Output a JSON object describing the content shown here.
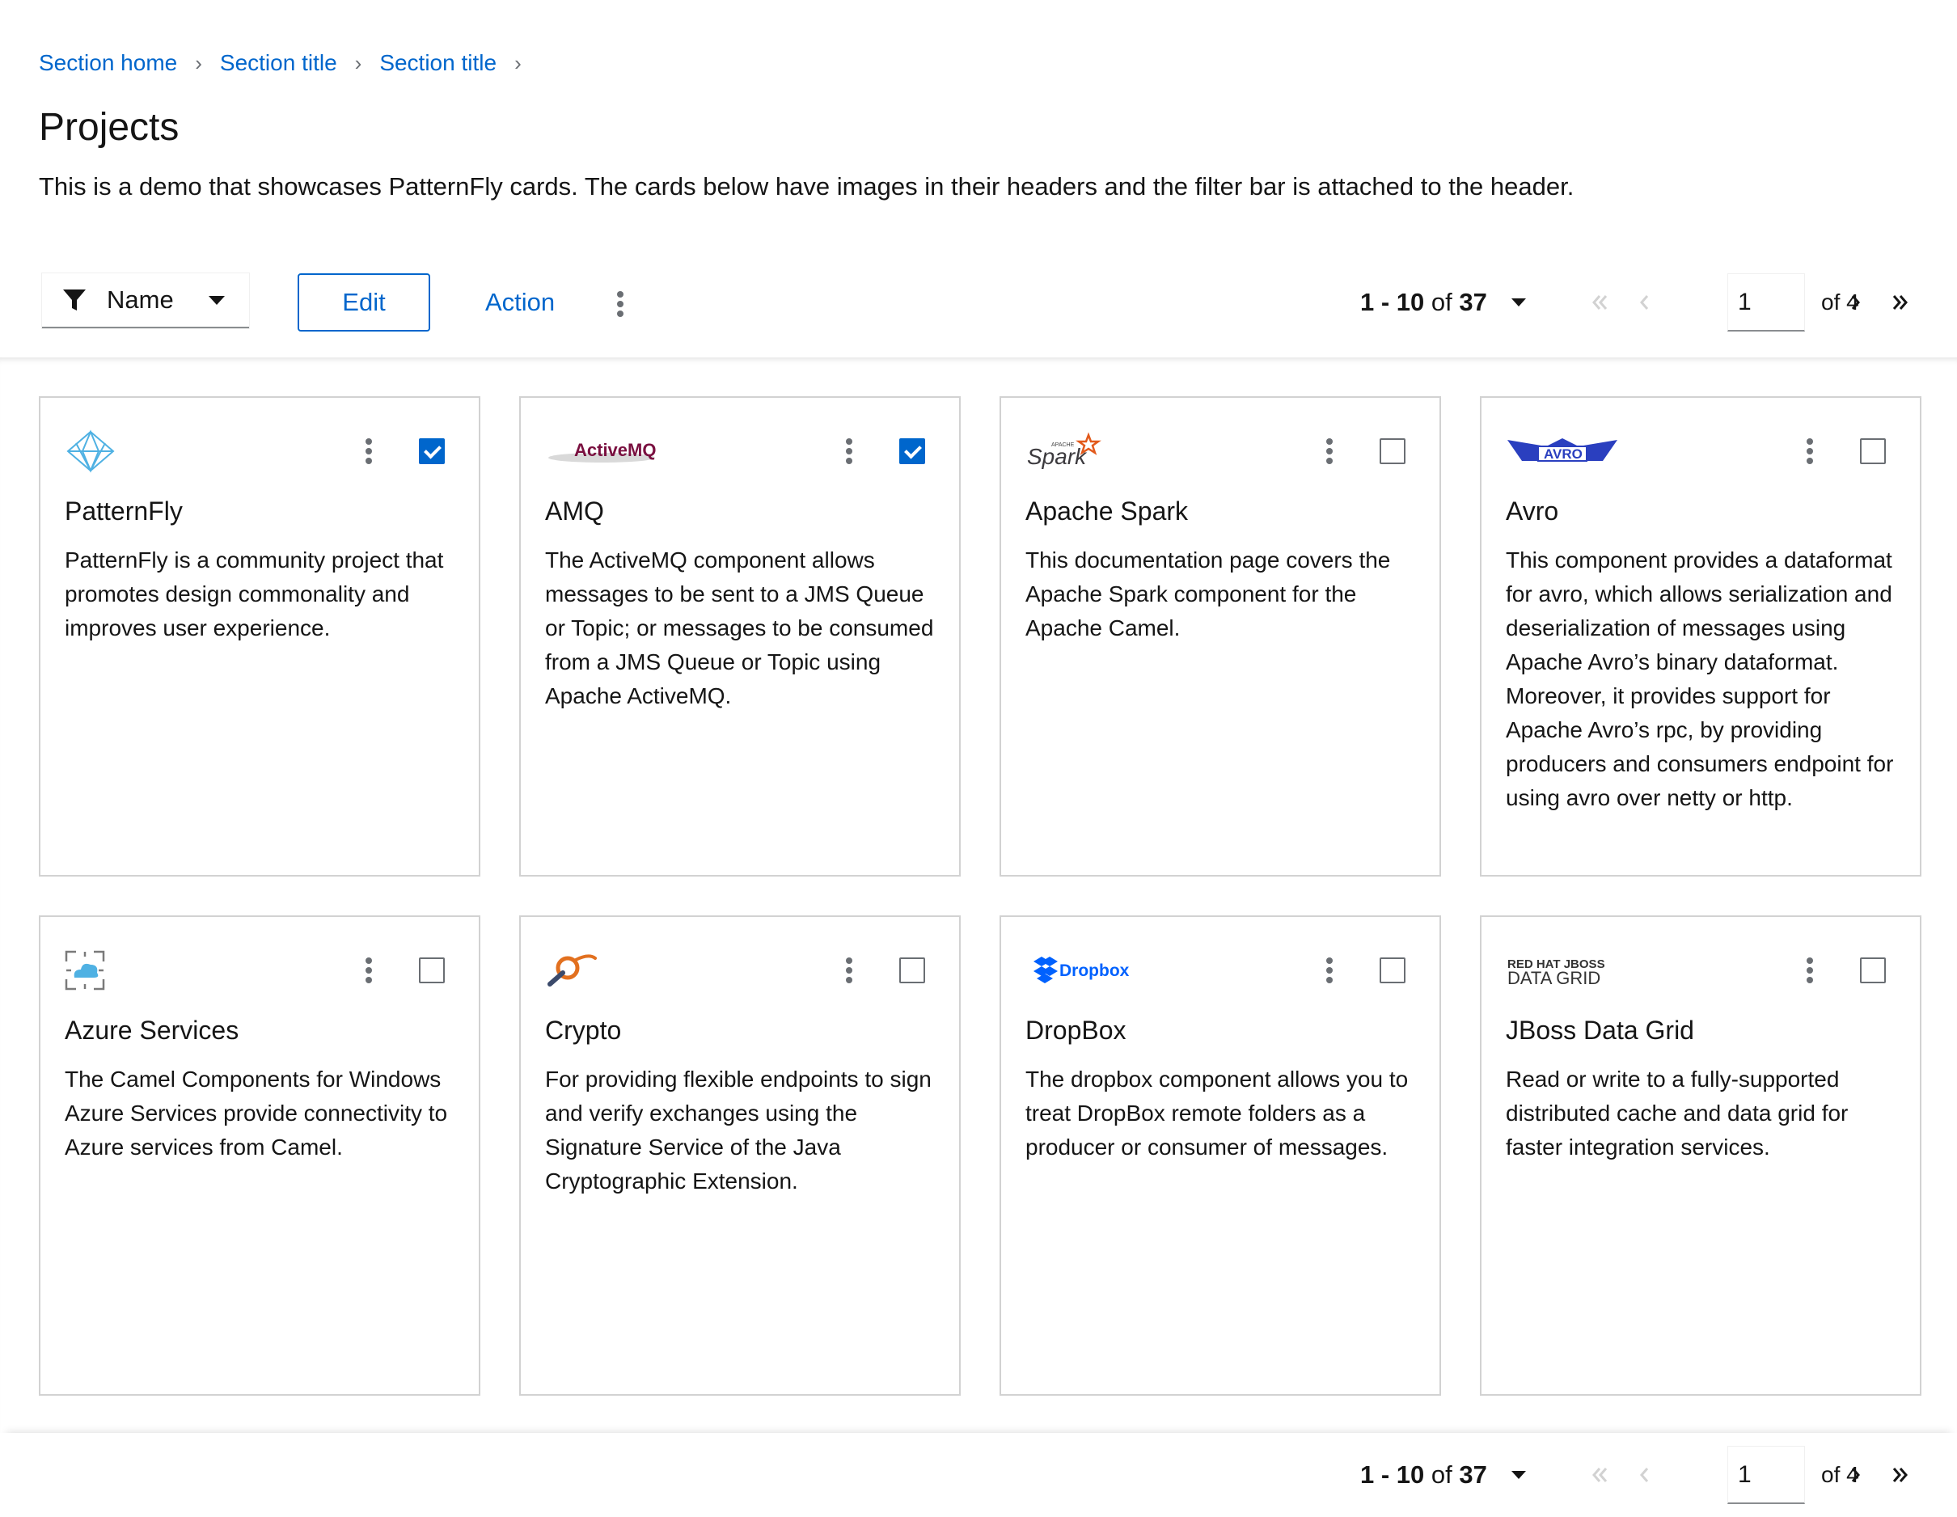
{
  "breadcrumb": {
    "items": [
      "Section home",
      "Section title",
      "Section title"
    ]
  },
  "page": {
    "title": "Projects",
    "description": "This is a demo that showcases PatternFly cards. The cards below have images in their headers and the filter bar is attached to the header."
  },
  "toolbar": {
    "filter_label": "Name",
    "edit_label": "Edit",
    "action_label": "Action"
  },
  "pagination": {
    "range": "1 - 10",
    "of_text": "of",
    "total": "37",
    "page": "1",
    "of_pages": "of 4"
  },
  "colors": {
    "link": "#0066cc",
    "checked": "#0066cc",
    "border": "#d2d2d2"
  },
  "cards": [
    {
      "logo": "patternfly-logo",
      "title": "PatternFly",
      "checked": true,
      "body": "PatternFly is a community project that promotes design commonality and improves user experience."
    },
    {
      "logo": "activemq-logo",
      "logo_text": "ActiveMQ",
      "title": "AMQ",
      "checked": true,
      "body": "The ActiveMQ component allows messages to be sent to a JMS Queue or Topic; or messages to be consumed from a JMS Queue or Topic using Apache ActiveMQ."
    },
    {
      "logo": "spark-logo",
      "logo_text": "Spark",
      "logo_small": "APACHE",
      "title": "Apache Spark",
      "checked": false,
      "body": "This documentation page covers the Apache Spark component for the Apache Camel."
    },
    {
      "logo": "avro-logo",
      "logo_text": "AVRO",
      "title": "Avro",
      "checked": false,
      "body": "This component provides a dataformat for avro, which allows serialization and deserialization of messages using Apache Avro’s binary dataformat. Moreover, it provides support for Apache Avro’s rpc, by providing producers and consumers endpoint for using avro over netty or http."
    },
    {
      "logo": "azure-logo",
      "title": "Azure Services",
      "checked": false,
      "body": "The Camel Components for Windows Azure Services provide connectivity to Azure services from Camel."
    },
    {
      "logo": "crypto-logo",
      "title": "Crypto",
      "checked": false,
      "body": "For providing flexible endpoints to sign and verify exchanges using the Signature Service of the Java Cryptographic Extension."
    },
    {
      "logo": "dropbox-logo",
      "logo_text": "Dropbox",
      "title": "DropBox",
      "checked": false,
      "body": "The dropbox component allows you to treat DropBox remote folders as a producer or consumer of messages."
    },
    {
      "logo": "jboss-logo",
      "logo_text": "RED HAT JBOSS",
      "logo_text2": "DATA GRID",
      "title": "JBoss Data Grid",
      "checked": false,
      "body": "Read or write to a fully-supported distributed cache and data grid for faster integration services."
    }
  ]
}
